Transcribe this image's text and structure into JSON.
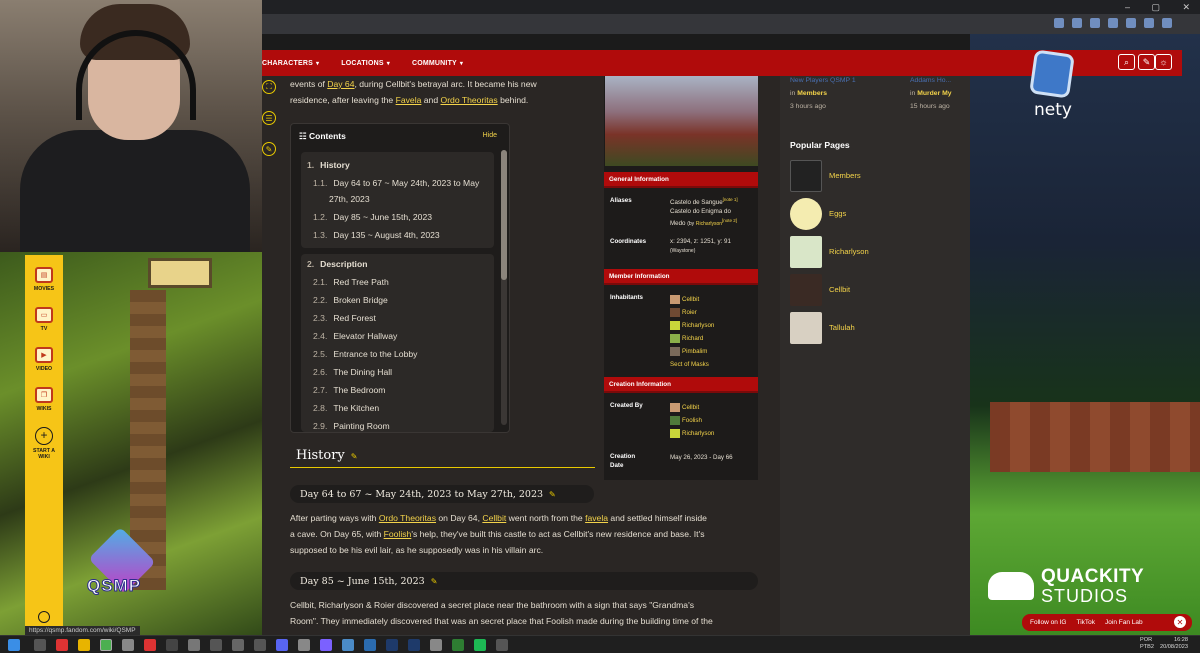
{
  "window": {
    "minimize": "–",
    "maximize": "▢",
    "close": "✕"
  },
  "nav": {
    "items": [
      "CHARACTERS",
      "LOCATIONS",
      "COMMUNITY"
    ],
    "caret": "▾"
  },
  "article": {
    "intro_prefix": "events of",
    "intro_link1": "Day 64",
    "intro_mid": ", during Cellbit's betrayal arc. It became his new",
    "intro_line2_prefix": "residence, after leaving the",
    "intro_link2": "Favela",
    "intro_and": "and",
    "intro_link3": "Ordo Theoritas",
    "intro_suffix": "behind.",
    "history_heading": "History",
    "h3_1": "Day 64 to 67 ~ May 24th, 2023 to May 27th, 2023",
    "para1": {
      "a": "After parting ways with",
      "l1": "Ordo Theoritas",
      "b": "on Day 64,",
      "l2": "Cellbit",
      "c": "went north from the",
      "l3": "favela",
      "d": "and settled himself inside",
      "e": "a cave. On Day 65, with",
      "l4": "Foolish",
      "f": "'s help, they've built this castle to act as Cellbit's new residence and base. It's",
      "g": "supposed to be his evil lair, as he supposedly was in his villain arc."
    },
    "h3_2": "Day 85 ~ June 15th, 2023",
    "para2_l1": "Cellbit, Richarlyson & Roier discovered a secret place near the bathroom with a sign that says \"Grandma's",
    "para2_l2": "Room\". They immediately discovered that was an secret place that Foolish made during the building time of the"
  },
  "toc": {
    "title": "Contents",
    "hide": "Hide",
    "section1": {
      "num": "1.",
      "label": "History"
    },
    "section1_items": [
      {
        "num": "1.1.",
        "label": "Day 64 to 67 ~ May 24th, 2023 to May",
        "label2": "27th, 2023"
      },
      {
        "num": "1.2.",
        "label": "Day 85 ~ June 15th, 2023"
      },
      {
        "num": "1.3.",
        "label": "Day 135 ~ August 4th, 2023"
      }
    ],
    "section2": {
      "num": "2.",
      "label": "Description"
    },
    "section2_items": [
      {
        "num": "2.1.",
        "label": "Red Tree Path"
      },
      {
        "num": "2.2.",
        "label": "Broken Bridge"
      },
      {
        "num": "2.3.",
        "label": "Red Forest"
      },
      {
        "num": "2.4.",
        "label": "Elevator Hallway"
      },
      {
        "num": "2.5.",
        "label": "Entrance to the Lobby"
      },
      {
        "num": "2.6.",
        "label": "The Dining Hall"
      },
      {
        "num": "2.7.",
        "label": "The Bedroom"
      },
      {
        "num": "2.8.",
        "label": "The Kitchen"
      },
      {
        "num": "2.9.",
        "label": "Painting Room"
      }
    ]
  },
  "infobox": {
    "general_header": "General Information",
    "aliases_label": "Aliases",
    "alias1": "Castelo de Sangue",
    "alias1_note": "[note 1]",
    "alias2": "Castelo do Enigma do",
    "alias2b": "Medo",
    "alias2_by": "(by",
    "alias2_who": "Richarlyson",
    "alias2_note": "[note 2]",
    "coords_label": "Coordinates",
    "coords": "x: 2394, z: 1251, y: 91",
    "coords_note": "(Waystone)",
    "member_header": "Member Information",
    "inhabitants_label": "Inhabitants",
    "inhabitants": [
      "Cellbit",
      "Roier",
      "Richarlyson",
      "Richard",
      "Pimbalim",
      "Sect of Masks"
    ],
    "creation_header": "Creation Information",
    "created_by_label": "Created By",
    "created_by": [
      "Cellbit",
      "Foolish",
      "Richarlyson"
    ],
    "creation_date_label1": "Creation",
    "creation_date_label2": "Date",
    "creation_date": "May 26, 2023 - Day 66"
  },
  "rail": {
    "recent1_title": "New Players QSMP 1",
    "recent1_in": "in",
    "recent1_where": "Members",
    "recent1_time": "3 hours ago",
    "recent2_title": "Addams Ho...",
    "recent2_in": "in",
    "recent2_where": "Murder My",
    "recent2_time": "15 hours ago",
    "popular_title": "Popular Pages",
    "popular": [
      "Members",
      "Eggs",
      "Richarlyson",
      "Cellbit",
      "Tallulah"
    ]
  },
  "fandom_sidebar": {
    "items": [
      "MOVIES",
      "TV",
      "VIDEO",
      "WIKIS"
    ],
    "start_a_wiki_l1": "START A",
    "start_a_wiki_l2": "WIKI",
    "plus": "+"
  },
  "overlay": {
    "qsmp_logo": "QSMP",
    "nety": "nety",
    "quackity_l1": "QUACKITY",
    "quackity_l2": "STUDIOS",
    "fan_follow": "Follow on IG",
    "fan_tiktok": "TikTok",
    "fan_join": "Join Fan Lab",
    "close": "✕"
  },
  "status_url": "https://qsmp.fandom.com/wiki/QSMP",
  "taskbar": {
    "lang1": "POR",
    "lang2": "PTB2",
    "time": "16:28",
    "date": "20/08/2023"
  },
  "colors": {
    "fandom_red": "#b00b0b",
    "link_yellow": "#f3d34a",
    "sidebar_yellow": "#f6c517"
  }
}
